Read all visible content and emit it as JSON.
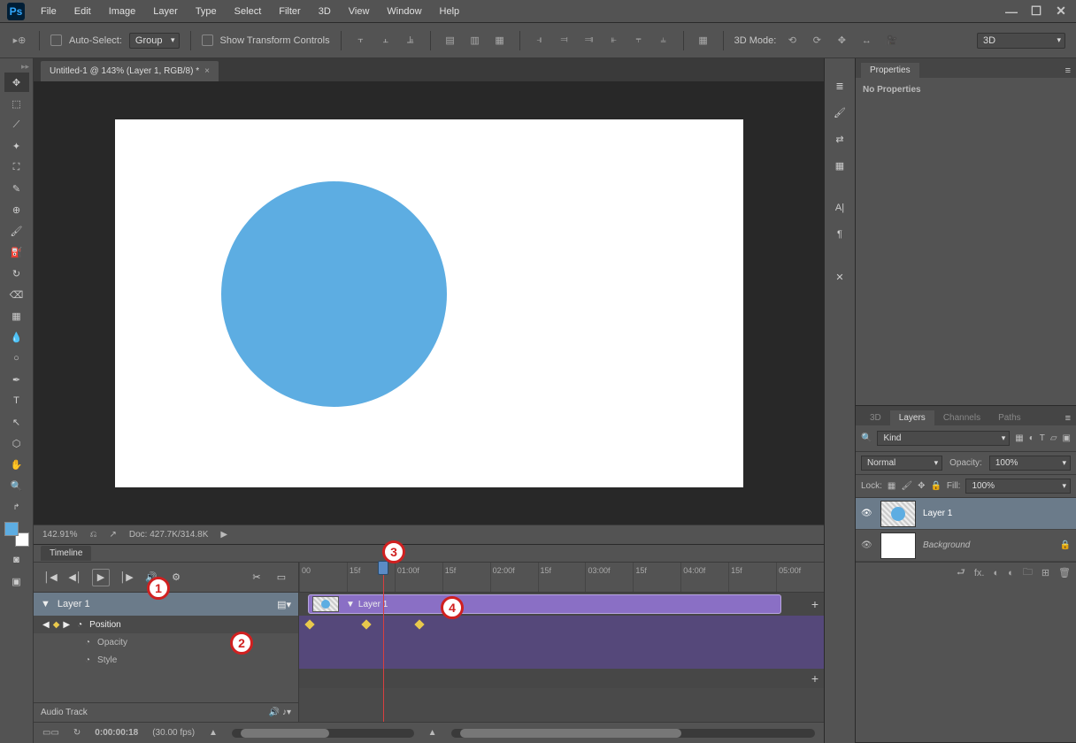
{
  "app_logo": "Ps",
  "menu": [
    "File",
    "Edit",
    "Image",
    "Layer",
    "Type",
    "Select",
    "Filter",
    "3D",
    "View",
    "Window",
    "Help"
  ],
  "options_bar": {
    "auto_select": "Auto-Select:",
    "group": "Group",
    "show_transform": "Show Transform Controls",
    "mode_3d": "3D Mode:",
    "view_3d": "3D"
  },
  "doc_tab": "Untitled-1 @ 143% (Layer 1, RGB/8) *",
  "status": {
    "zoom": "142.91%",
    "doc": "Doc: 427.7K/314.8K"
  },
  "timeline": {
    "tab": "Timeline",
    "layer_name": "Layer 1",
    "clip_name": "Layer 1",
    "properties": [
      "Position",
      "Opacity",
      "Style"
    ],
    "audio_track": "Audio Track",
    "ruler": [
      "00",
      "15f",
      "01:00f",
      "15f",
      "02:00f",
      "15f",
      "03:00f",
      "15f",
      "04:00f",
      "15f",
      "05:00f"
    ],
    "footer_time": "0:00:00:18",
    "footer_fps": "(30.00 fps)"
  },
  "callouts": [
    "1",
    "2",
    "3",
    "4"
  ],
  "properties_panel": {
    "tab": "Properties",
    "msg": "No Properties"
  },
  "layers_panel": {
    "tabs": [
      "3D",
      "Layers",
      "Channels",
      "Paths"
    ],
    "kind": "Kind",
    "blend": "Normal",
    "opacity_label": "Opacity:",
    "opacity_val": "100%",
    "lock_label": "Lock:",
    "fill_label": "Fill:",
    "fill_val": "100%",
    "layers": [
      {
        "name": "Layer 1",
        "selected": true,
        "white": false
      },
      {
        "name": "Background",
        "selected": false,
        "white": true,
        "locked": true
      }
    ]
  },
  "icons": {
    "minimize": "—",
    "maximize": "☐",
    "close": "✕",
    "play": "▶",
    "frame_back": "◀│",
    "frame_fwd": "│▶",
    "first": "│◀",
    "last": "▶│",
    "speaker": "🔊",
    "gear": "⚙",
    "scissors": "✂",
    "split": "▭",
    "triangle": "▼",
    "diamond": "◆",
    "plus": "+",
    "trash": "🗑",
    "link": "⮐",
    "fx": "fx.",
    "mask": "◐",
    "folder": "🗀",
    "newlayer": "⊞",
    "lock": "🔒",
    "eye": "👁",
    "note": "♪",
    "menu": "≡"
  }
}
